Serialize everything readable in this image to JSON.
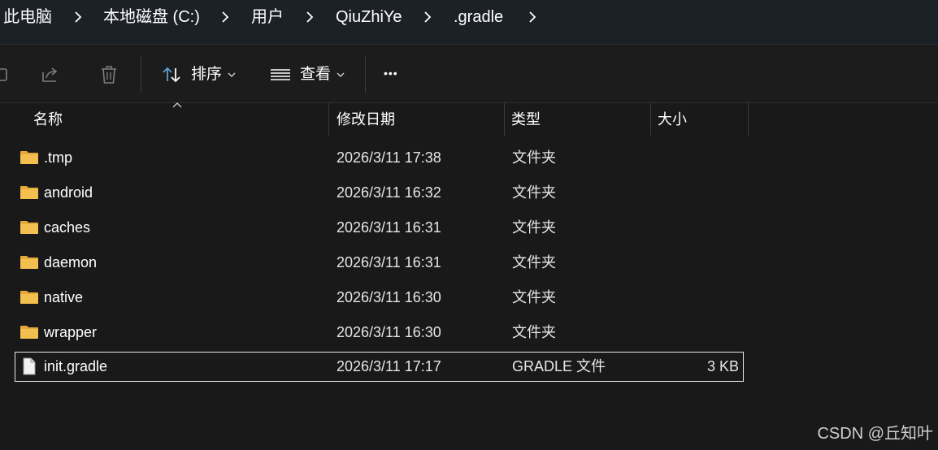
{
  "breadcrumb": {
    "items": [
      "此电脑",
      "本地磁盘 (C:)",
      "用户",
      "QiuZhiYe",
      ".gradle"
    ]
  },
  "toolbar": {
    "icons": [
      "rename-icon",
      "share-icon",
      "delete-icon"
    ],
    "sort_label": "排序",
    "view_label": "查看",
    "more_label": "•••"
  },
  "columns": {
    "name": "名称",
    "date": "修改日期",
    "type": "类型",
    "size": "大小"
  },
  "files": [
    {
      "name": ".tmp",
      "date": "2026/3/11 17:38",
      "type": "文件夹",
      "size": "",
      "icon": "folder-icon"
    },
    {
      "name": "android",
      "date": "2026/3/11 16:32",
      "type": "文件夹",
      "size": "",
      "icon": "folder-icon"
    },
    {
      "name": "caches",
      "date": "2026/3/11 16:31",
      "type": "文件夹",
      "size": "",
      "icon": "folder-icon"
    },
    {
      "name": "daemon",
      "date": "2026/3/11 16:31",
      "type": "文件夹",
      "size": "",
      "icon": "folder-icon"
    },
    {
      "name": "native",
      "date": "2026/3/11 16:30",
      "type": "文件夹",
      "size": "",
      "icon": "folder-icon"
    },
    {
      "name": "wrapper",
      "date": "2026/3/11 16:30",
      "type": "文件夹",
      "size": "",
      "icon": "folder-icon"
    },
    {
      "name": "init.gradle",
      "date": "2026/3/11 17:17",
      "type": "GRADLE 文件",
      "size": "3 KB",
      "icon": "file-icon"
    }
  ],
  "watermark": "CSDN @丘知叶",
  "colors": {
    "background": "#191919",
    "folder": "#f3c04f",
    "accent_icon": "#5aa0d8"
  }
}
